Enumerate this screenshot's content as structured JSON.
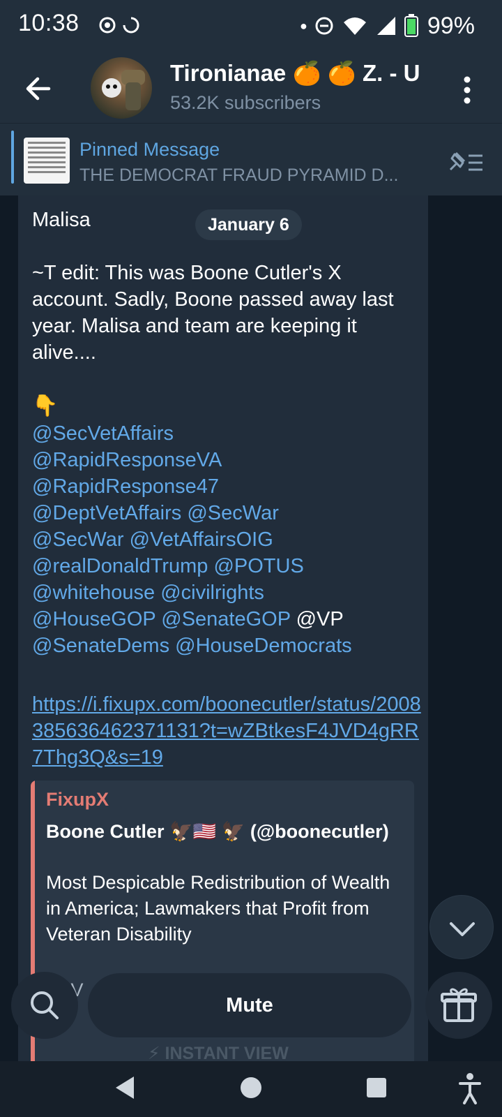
{
  "status_bar": {
    "time": "10:38",
    "battery": "99%"
  },
  "header": {
    "title": "Tironianae 🍊 🍊 Z. - U",
    "subscribers": "53.2K subscribers"
  },
  "pinned": {
    "label": "Pinned Message",
    "text": "THE DEMOCRAT FRAUD PYRAMID  D..."
  },
  "message": {
    "sender": "Malisa",
    "date": "January 6",
    "body": "~T edit: This was Boone Cutler's X account. Sadly, Boone passed away last year. Malisa and team are keeping it alive....",
    "emoji": "👇",
    "mention_lines": [
      [
        {
          "t": "@SecVetAffairs",
          "m": true
        }
      ],
      [
        {
          "t": "@RapidResponseVA",
          "m": true
        }
      ],
      [
        {
          "t": "@RapidResponse47",
          "m": true
        }
      ],
      [
        {
          "t": "@DeptVetAffairs",
          "m": true
        },
        {
          "t": " ",
          "m": false
        },
        {
          "t": "@SecWar",
          "m": true
        }
      ],
      [
        {
          "t": "@SecWar",
          "m": true
        },
        {
          "t": " ",
          "m": false
        },
        {
          "t": "@VetAffairsOIG",
          "m": true
        }
      ],
      [
        {
          "t": "@realDonaldTrump",
          "m": true
        },
        {
          "t": " ",
          "m": false
        },
        {
          "t": "@POTUS",
          "m": true
        }
      ],
      [
        {
          "t": "@whitehouse",
          "m": true
        },
        {
          "t": " ",
          "m": false
        },
        {
          "t": "@civilrights",
          "m": true
        }
      ],
      [
        {
          "t": "@HouseGOP",
          "m": true
        },
        {
          "t": " ",
          "m": false
        },
        {
          "t": "@SenateGOP",
          "m": true
        },
        {
          "t": " @VP",
          "m": false
        }
      ],
      [
        {
          "t": "@SenateDems",
          "m": true
        },
        {
          "t": " ",
          "m": false
        },
        {
          "t": "@HouseDemocrats",
          "m": true
        }
      ]
    ],
    "link": "https://i.fixupx.com/boonecutler/status/2008385636462371131?t=wZBtkesF4JVD4gRR7Thg3Q&s=19",
    "preview": {
      "site": "FixupX",
      "title": "Boone Cutler 🦅🇺🇸 🦅 (@boonecutler)",
      "description": "Most Despicable Redistribution of Wealth in America; Lawmakers that Profit from Veteran Disability",
      "extra": "HAV\n.M",
      "instant_view": "⚡ INSTANT VIEW"
    }
  },
  "bottom": {
    "mute_label": "Mute"
  },
  "colors": {
    "accent": "#62a9e8",
    "preview_accent": "#e47c74",
    "bubble": "#212d3b"
  },
  "icons": {
    "back": "back-arrow-icon",
    "more": "more-vertical-icon",
    "pin_list": "pin-list-icon",
    "scroll_down": "chevron-down-icon",
    "search": "search-icon",
    "gift": "gift-icon"
  }
}
